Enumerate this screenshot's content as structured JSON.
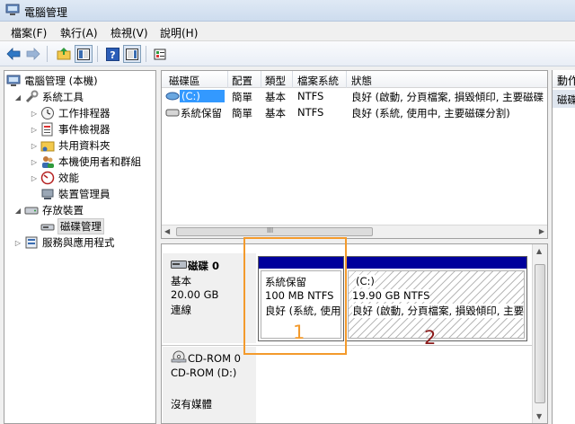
{
  "window": {
    "title": "電腦管理"
  },
  "menu": [
    "檔案(F)",
    "執行(A)",
    "檢視(V)",
    "說明(H)"
  ],
  "tree": {
    "root": "電腦管理 (本機)",
    "system_tools": "系統工具",
    "task_scheduler": "工作排程器",
    "event_viewer": "事件檢視器",
    "shared_folders": "共用資料夾",
    "local_users": "本機使用者和群組",
    "performance": "效能",
    "device_manager": "裝置管理員",
    "storage": "存放裝置",
    "disk_management": "磁碟管理",
    "services_apps": "服務與應用程式"
  },
  "volumes": {
    "headers": [
      "磁碟區",
      "配置",
      "類型",
      "檔案系統",
      "狀態"
    ],
    "rows": [
      {
        "name": "(C:)",
        "layout": "簡單",
        "type": "基本",
        "fs": "NTFS",
        "status": "良好 (啟動, 分頁檔案, 損毀傾印, 主要磁碟"
      },
      {
        "name": "系統保留",
        "layout": "簡單",
        "type": "基本",
        "fs": "NTFS",
        "status": "良好 (系統, 使用中, 主要磁碟分割)"
      }
    ],
    "scroll_glyph": "III"
  },
  "actions": {
    "header": "動作",
    "sub": "磁碟管理"
  },
  "disks": {
    "disk0": {
      "name": "磁碟 0",
      "type": "基本",
      "size": "20.00 GB",
      "status": "連線"
    },
    "partitions": [
      {
        "label": "系統保留",
        "size": "100 MB NTFS",
        "status": "良好 (系統, 使用中"
      },
      {
        "label": "(C:)",
        "size": "19.90 GB NTFS",
        "status": "良好 (啟動, 分頁檔案, 損毀傾印, 主要"
      }
    ],
    "cdrom": {
      "name": "CD-ROM 0",
      "drive": "CD-ROM (D:)",
      "status": "沒有媒體"
    }
  },
  "annotations": {
    "one": "1",
    "two": "2",
    "one_color": "#f39a2c",
    "two_color": "#8b1a1a"
  }
}
